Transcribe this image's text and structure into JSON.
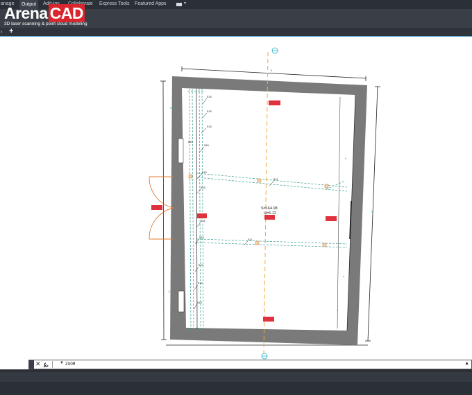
{
  "ribbon": {
    "tabs": [
      {
        "label": "anage",
        "active": false
      },
      {
        "label": "Output",
        "active": true
      },
      {
        "label": "Add-ins",
        "active": false
      },
      {
        "label": "Collaborate",
        "active": false
      },
      {
        "label": "Express Tools",
        "active": false
      },
      {
        "label": "Featured Apps",
        "active": false
      }
    ]
  },
  "logo": {
    "word_left": "Arena",
    "word_right": "CAD",
    "tagline": "3D laser scanning & point cloud modeling"
  },
  "tabbar": {
    "new_tab": "+",
    "scroll_left": "‹"
  },
  "drawing": {
    "labels": {
      "area": "S=164.98",
      "height": "H=5.12",
      "tag_511_a": "511",
      "tag_511_b": "511",
      "tag_515": "515",
      "tag_869": "869"
    },
    "colors": {
      "wall": "#7a7a7a",
      "axis": "#f2a93b",
      "cyan": "#1fb5c8",
      "teal_beam": "#2e9b8e",
      "red_tag": "#e0323c",
      "door": "#e07b2e",
      "line": "#222222"
    }
  },
  "command": {
    "close_icon": "close-icon",
    "wrench_icon": "wrench-icon",
    "prompt": "ZOOM"
  }
}
